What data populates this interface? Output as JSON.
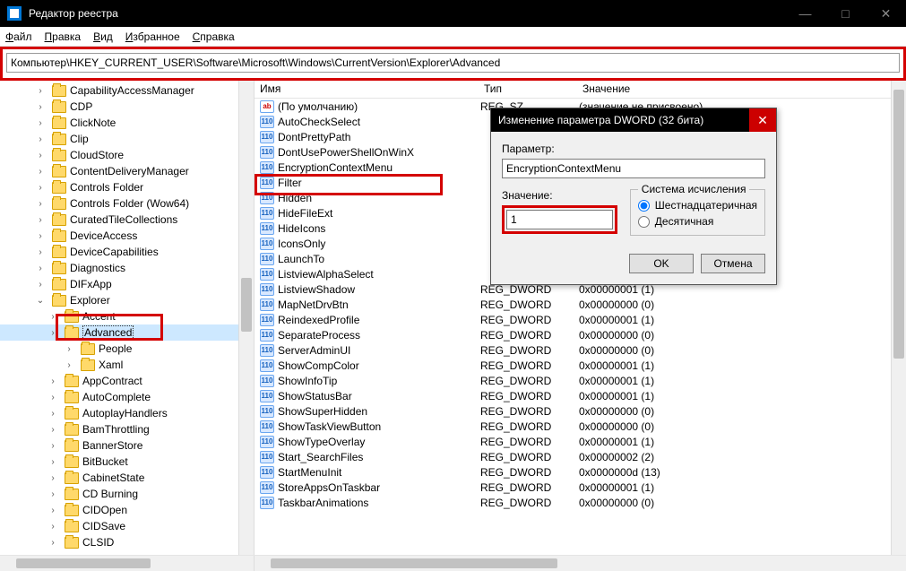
{
  "window": {
    "title": "Редактор реестра"
  },
  "menubar": [
    "Файл",
    "Правка",
    "Вид",
    "Избранное",
    "Справка"
  ],
  "address": "Компьютер\\HKEY_CURRENT_USER\\Software\\Microsoft\\Windows\\CurrentVersion\\Explorer\\Advanced",
  "list_headers": {
    "name": "Имя",
    "type": "Тип",
    "value": "Значение"
  },
  "tree": [
    {
      "label": "CapabilityAccessManager",
      "lvl": 1
    },
    {
      "label": "CDP",
      "lvl": 1
    },
    {
      "label": "ClickNote",
      "lvl": 1
    },
    {
      "label": "Clip",
      "lvl": 1
    },
    {
      "label": "CloudStore",
      "lvl": 1
    },
    {
      "label": "ContentDeliveryManager",
      "lvl": 1
    },
    {
      "label": "Controls Folder",
      "lvl": 1
    },
    {
      "label": "Controls Folder (Wow64)",
      "lvl": 1
    },
    {
      "label": "CuratedTileCollections",
      "lvl": 1
    },
    {
      "label": "DeviceAccess",
      "lvl": 1
    },
    {
      "label": "DeviceCapabilities",
      "lvl": 1
    },
    {
      "label": "Diagnostics",
      "lvl": 1
    },
    {
      "label": "DIFxApp",
      "lvl": 1
    },
    {
      "label": "Explorer",
      "lvl": 1,
      "open": true
    },
    {
      "label": "Accent",
      "lvl": 2
    },
    {
      "label": "Advanced",
      "lvl": 2,
      "sel": true,
      "hi": true
    },
    {
      "label": "People",
      "lvl": 3
    },
    {
      "label": "Xaml",
      "lvl": 3
    },
    {
      "label": "AppContract",
      "lvl": 2
    },
    {
      "label": "AutoComplete",
      "lvl": 2
    },
    {
      "label": "AutoplayHandlers",
      "lvl": 2
    },
    {
      "label": "BamThrottling",
      "lvl": 2
    },
    {
      "label": "BannerStore",
      "lvl": 2
    },
    {
      "label": "BitBucket",
      "lvl": 2
    },
    {
      "label": "CabinetState",
      "lvl": 2
    },
    {
      "label": "CD Burning",
      "lvl": 2
    },
    {
      "label": "CIDOpen",
      "lvl": 2
    },
    {
      "label": "CIDSave",
      "lvl": 2
    },
    {
      "label": "CLSID",
      "lvl": 2
    }
  ],
  "values": [
    {
      "name": "(По умолчанию)",
      "type": "REG_SZ",
      "data": "(значение не присвоено)",
      "ic": "sz"
    },
    {
      "name": "AutoCheckSelect",
      "type": "",
      "data": "",
      "ic": "bin"
    },
    {
      "name": "DontPrettyPath",
      "type": "",
      "data": "",
      "ic": "bin"
    },
    {
      "name": "DontUsePowerShellOnWinX",
      "type": "",
      "data": "",
      "ic": "bin"
    },
    {
      "name": "EncryptionContextMenu",
      "type": "",
      "data": "",
      "ic": "bin",
      "hi": true
    },
    {
      "name": "Filter",
      "type": "",
      "data": "",
      "ic": "bin"
    },
    {
      "name": "Hidden",
      "type": "",
      "data": "",
      "ic": "bin"
    },
    {
      "name": "HideFileExt",
      "type": "",
      "data": "",
      "ic": "bin"
    },
    {
      "name": "HideIcons",
      "type": "",
      "data": "",
      "ic": "bin"
    },
    {
      "name": "IconsOnly",
      "type": "",
      "data": "",
      "ic": "bin"
    },
    {
      "name": "LaunchTo",
      "type": "",
      "data": "",
      "ic": "bin"
    },
    {
      "name": "ListviewAlphaSelect",
      "type": "",
      "data": "",
      "ic": "bin"
    },
    {
      "name": "ListviewShadow",
      "type": "REG_DWORD",
      "data": "0x00000001 (1)",
      "ic": "bin"
    },
    {
      "name": "MapNetDrvBtn",
      "type": "REG_DWORD",
      "data": "0x00000000 (0)",
      "ic": "bin"
    },
    {
      "name": "ReindexedProfile",
      "type": "REG_DWORD",
      "data": "0x00000001 (1)",
      "ic": "bin"
    },
    {
      "name": "SeparateProcess",
      "type": "REG_DWORD",
      "data": "0x00000000 (0)",
      "ic": "bin"
    },
    {
      "name": "ServerAdminUI",
      "type": "REG_DWORD",
      "data": "0x00000000 (0)",
      "ic": "bin"
    },
    {
      "name": "ShowCompColor",
      "type": "REG_DWORD",
      "data": "0x00000001 (1)",
      "ic": "bin"
    },
    {
      "name": "ShowInfoTip",
      "type": "REG_DWORD",
      "data": "0x00000001 (1)",
      "ic": "bin"
    },
    {
      "name": "ShowStatusBar",
      "type": "REG_DWORD",
      "data": "0x00000001 (1)",
      "ic": "bin"
    },
    {
      "name": "ShowSuperHidden",
      "type": "REG_DWORD",
      "data": "0x00000000 (0)",
      "ic": "bin"
    },
    {
      "name": "ShowTaskViewButton",
      "type": "REG_DWORD",
      "data": "0x00000000 (0)",
      "ic": "bin"
    },
    {
      "name": "ShowTypeOverlay",
      "type": "REG_DWORD",
      "data": "0x00000001 (1)",
      "ic": "bin"
    },
    {
      "name": "Start_SearchFiles",
      "type": "REG_DWORD",
      "data": "0x00000002 (2)",
      "ic": "bin"
    },
    {
      "name": "StartMenuInit",
      "type": "REG_DWORD",
      "data": "0x0000000d (13)",
      "ic": "bin"
    },
    {
      "name": "StoreAppsOnTaskbar",
      "type": "REG_DWORD",
      "data": "0x00000001 (1)",
      "ic": "bin"
    },
    {
      "name": "TaskbarAnimations",
      "type": "REG_DWORD",
      "data": "0x00000000 (0)",
      "ic": "bin"
    }
  ],
  "dialog": {
    "title": "Изменение параметра DWORD (32 бита)",
    "param_label": "Параметр:",
    "param_value": "EncryptionContextMenu",
    "value_label": "Значение:",
    "value_value": "1",
    "radix_legend": "Система исчисления",
    "radix_hex": "Шестнадцатеричная",
    "radix_dec": "Десятичная",
    "ok": "OK",
    "cancel": "Отмена"
  }
}
